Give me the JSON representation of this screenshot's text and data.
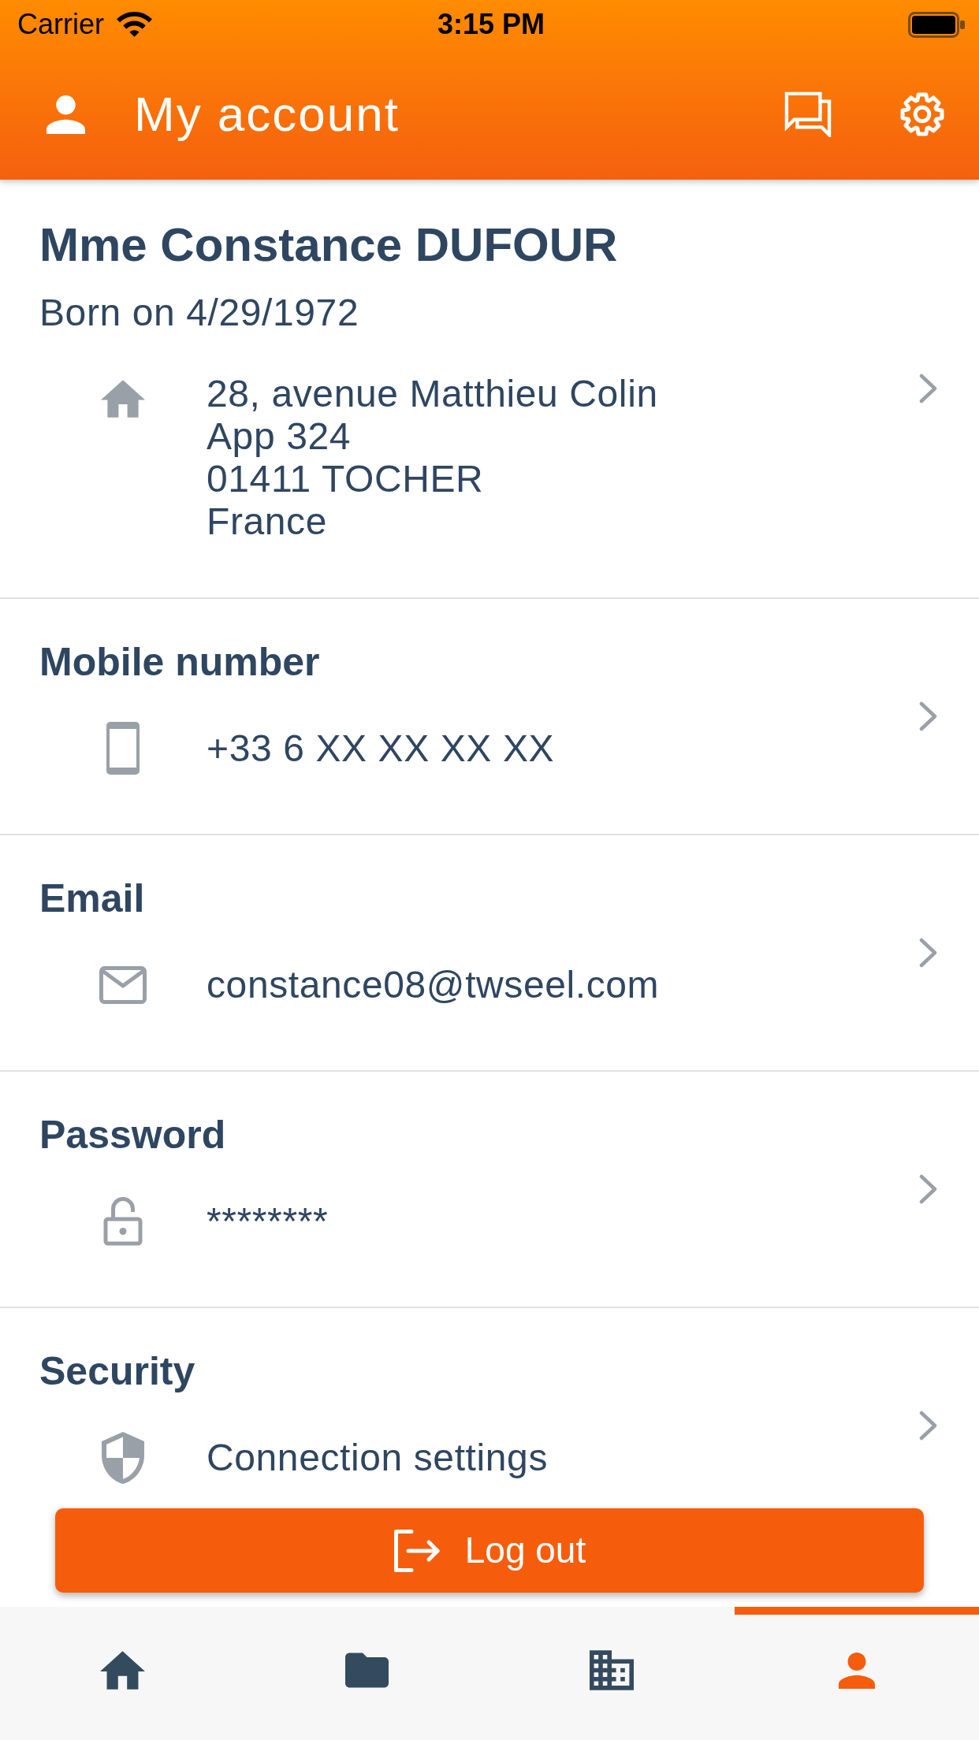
{
  "status_bar": {
    "carrier": "Carrier",
    "time": "3:15 PM"
  },
  "header": {
    "title": "My account"
  },
  "profile": {
    "name": "Mme Constance DUFOUR",
    "birth_date": "Born on 4/29/1972",
    "address": [
      "28, avenue Matthieu Colin",
      "App 324",
      "01411 TOCHER",
      "France"
    ]
  },
  "sections": [
    {
      "heading": "Mobile number",
      "value": "+33 6 XX XX XX XX"
    },
    {
      "heading": "Email",
      "value": "constance08@twseel.com"
    },
    {
      "heading": "Password",
      "value": "********"
    },
    {
      "heading": "Security",
      "value": "Connection settings"
    }
  ],
  "logout_button": {
    "label": "Log out"
  },
  "tab_bar": {
    "tabs": [
      {
        "selected": false
      },
      {
        "selected": false
      },
      {
        "selected": false
      },
      {
        "selected": true
      }
    ]
  }
}
